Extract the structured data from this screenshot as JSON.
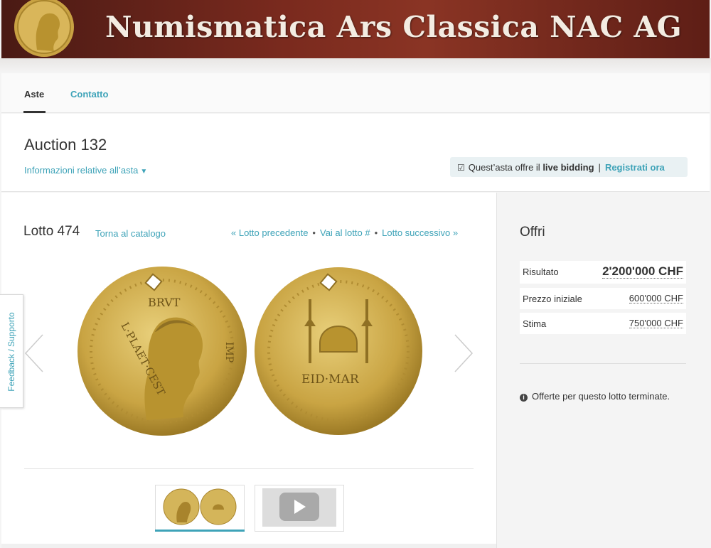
{
  "banner": {
    "title": "Numismatica Ars Classica NAC AG",
    "logo": "coin-logo-icon"
  },
  "nav": {
    "aste": "Aste",
    "contatto": "Contatto"
  },
  "auction": {
    "title": "Auction 132",
    "info_link": "Informazioni relative all’asta",
    "live_prefix": "Quest’asta offre il",
    "live_bold": "live bidding",
    "live_sep": "|",
    "register": "Registrati ora"
  },
  "lot": {
    "title": "Lotto 474",
    "back": "Torna al catalogo",
    "prev": "« Lotto precedente",
    "goto": "Vai al lotto #",
    "next": "Lotto successivo »",
    "coin_inscriptions": [
      "BRVT",
      "IMP",
      "L·PLAET·CEST",
      "EID·MAR"
    ]
  },
  "side": {
    "title": "Offri",
    "rows": [
      {
        "label": "Risultato",
        "value": "2'200'000 CHF"
      },
      {
        "label": "Prezzo iniziale",
        "value": "600'000 CHF"
      },
      {
        "label": "Stima",
        "value": "750'000 CHF"
      }
    ],
    "ended": "Offerte per questo lotto terminate."
  },
  "feedback": "Feedback / Supporto",
  "colors": {
    "accent": "#3ea3b8",
    "banner": "#7a2a1e",
    "gold": "#c9a84a"
  }
}
